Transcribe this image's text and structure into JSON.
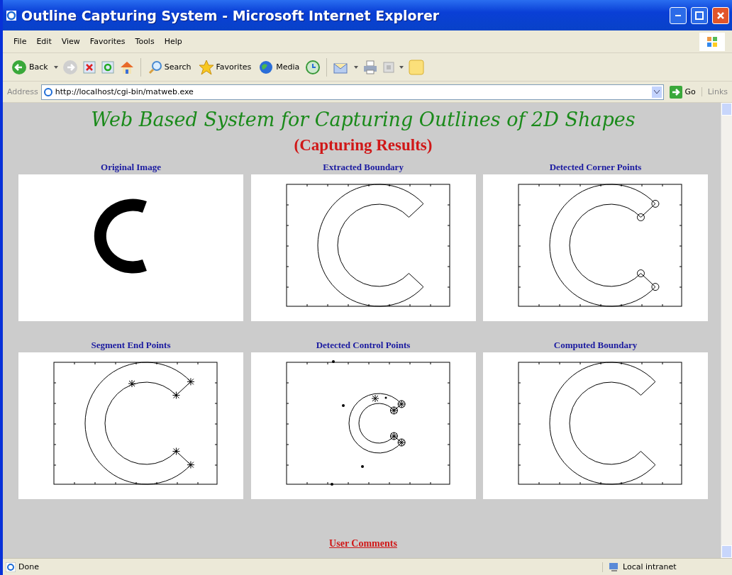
{
  "window": {
    "title": "Outline Capturing System - Microsoft Internet Explorer"
  },
  "menu": [
    "File",
    "Edit",
    "View",
    "Favorites",
    "Tools",
    "Help"
  ],
  "toolbar": {
    "back_label": "Back",
    "search_label": "Search",
    "favorites_label": "Favorites",
    "media_label": "Media"
  },
  "address_bar": {
    "label": "Address",
    "url": "http://localhost/cgi-bin/matweb.exe",
    "go_label": "Go",
    "links_label": "Links"
  },
  "page": {
    "heading": "Web Based  System for Capturing Outlines of 2D Shapes",
    "subheading": "(Capturing Results)",
    "panels": [
      {
        "caption": "Original Image",
        "kind": "original"
      },
      {
        "caption": "Extracted Boundary",
        "kind": "boundary"
      },
      {
        "caption": "Detected Corner Points",
        "kind": "corners"
      },
      {
        "caption": "Segment End Points",
        "kind": "endpoints"
      },
      {
        "caption": "Detected Control Points",
        "kind": "control"
      },
      {
        "caption": "Computed Boundary",
        "kind": "computed"
      }
    ],
    "link": "User Comments"
  },
  "status_bar": {
    "text": "Done",
    "zone": "Local intranet"
  }
}
